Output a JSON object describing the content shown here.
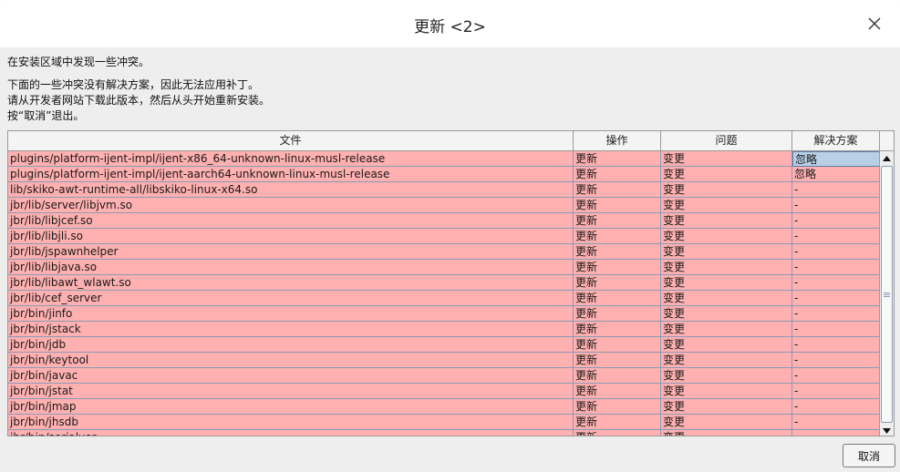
{
  "window": {
    "title": "更新 <2>"
  },
  "messages": {
    "line1": "在安装区域中发现一些冲突。",
    "line2": "下面的一些冲突没有解决方案，因此无法应用补丁。",
    "line3": "请从开发者网站下载此版本，然后从头开始重新安装。",
    "line4": "按“取消”退出。"
  },
  "table": {
    "headers": [
      "文件",
      "操作",
      "问题",
      "解决方案"
    ],
    "rows": [
      {
        "file": "plugins/platform-ijent-impl/ijent-x86_64-unknown-linux-musl-release",
        "action": "更新",
        "problem": "变更",
        "resolution": "忽略"
      },
      {
        "file": "plugins/platform-ijent-impl/ijent-aarch64-unknown-linux-musl-release",
        "action": "更新",
        "problem": "变更",
        "resolution": "忽略"
      },
      {
        "file": "lib/skiko-awt-runtime-all/libskiko-linux-x64.so",
        "action": "更新",
        "problem": "变更",
        "resolution": "-"
      },
      {
        "file": "jbr/lib/server/libjvm.so",
        "action": "更新",
        "problem": "变更",
        "resolution": "-"
      },
      {
        "file": "jbr/lib/libjcef.so",
        "action": "更新",
        "problem": "变更",
        "resolution": "-"
      },
      {
        "file": "jbr/lib/libjli.so",
        "action": "更新",
        "problem": "变更",
        "resolution": "-"
      },
      {
        "file": "jbr/lib/jspawnhelper",
        "action": "更新",
        "problem": "变更",
        "resolution": "-"
      },
      {
        "file": "jbr/lib/libjava.so",
        "action": "更新",
        "problem": "变更",
        "resolution": "-"
      },
      {
        "file": "jbr/lib/libawt_wlawt.so",
        "action": "更新",
        "problem": "变更",
        "resolution": "-"
      },
      {
        "file": "jbr/lib/cef_server",
        "action": "更新",
        "problem": "变更",
        "resolution": "-"
      },
      {
        "file": "jbr/bin/jinfo",
        "action": "更新",
        "problem": "变更",
        "resolution": "-"
      },
      {
        "file": "jbr/bin/jstack",
        "action": "更新",
        "problem": "变更",
        "resolution": "-"
      },
      {
        "file": "jbr/bin/jdb",
        "action": "更新",
        "problem": "变更",
        "resolution": "-"
      },
      {
        "file": "jbr/bin/keytool",
        "action": "更新",
        "problem": "变更",
        "resolution": "-"
      },
      {
        "file": "jbr/bin/javac",
        "action": "更新",
        "problem": "变更",
        "resolution": "-"
      },
      {
        "file": "jbr/bin/jstat",
        "action": "更新",
        "problem": "变更",
        "resolution": "-"
      },
      {
        "file": "jbr/bin/jmap",
        "action": "更新",
        "problem": "变更",
        "resolution": "-"
      },
      {
        "file": "jbr/bin/jhsdb",
        "action": "更新",
        "problem": "变更",
        "resolution": "-"
      },
      {
        "file": "jbr/bin/serialver",
        "action": "更新",
        "problem": "变更",
        "resolution": "-"
      }
    ]
  },
  "buttons": {
    "cancel": "取消"
  },
  "icons": {
    "close": "close-icon",
    "scroll_up": "arrow-up-icon",
    "scroll_down": "arrow-down-icon",
    "scroll_grip": "grip-icon"
  }
}
